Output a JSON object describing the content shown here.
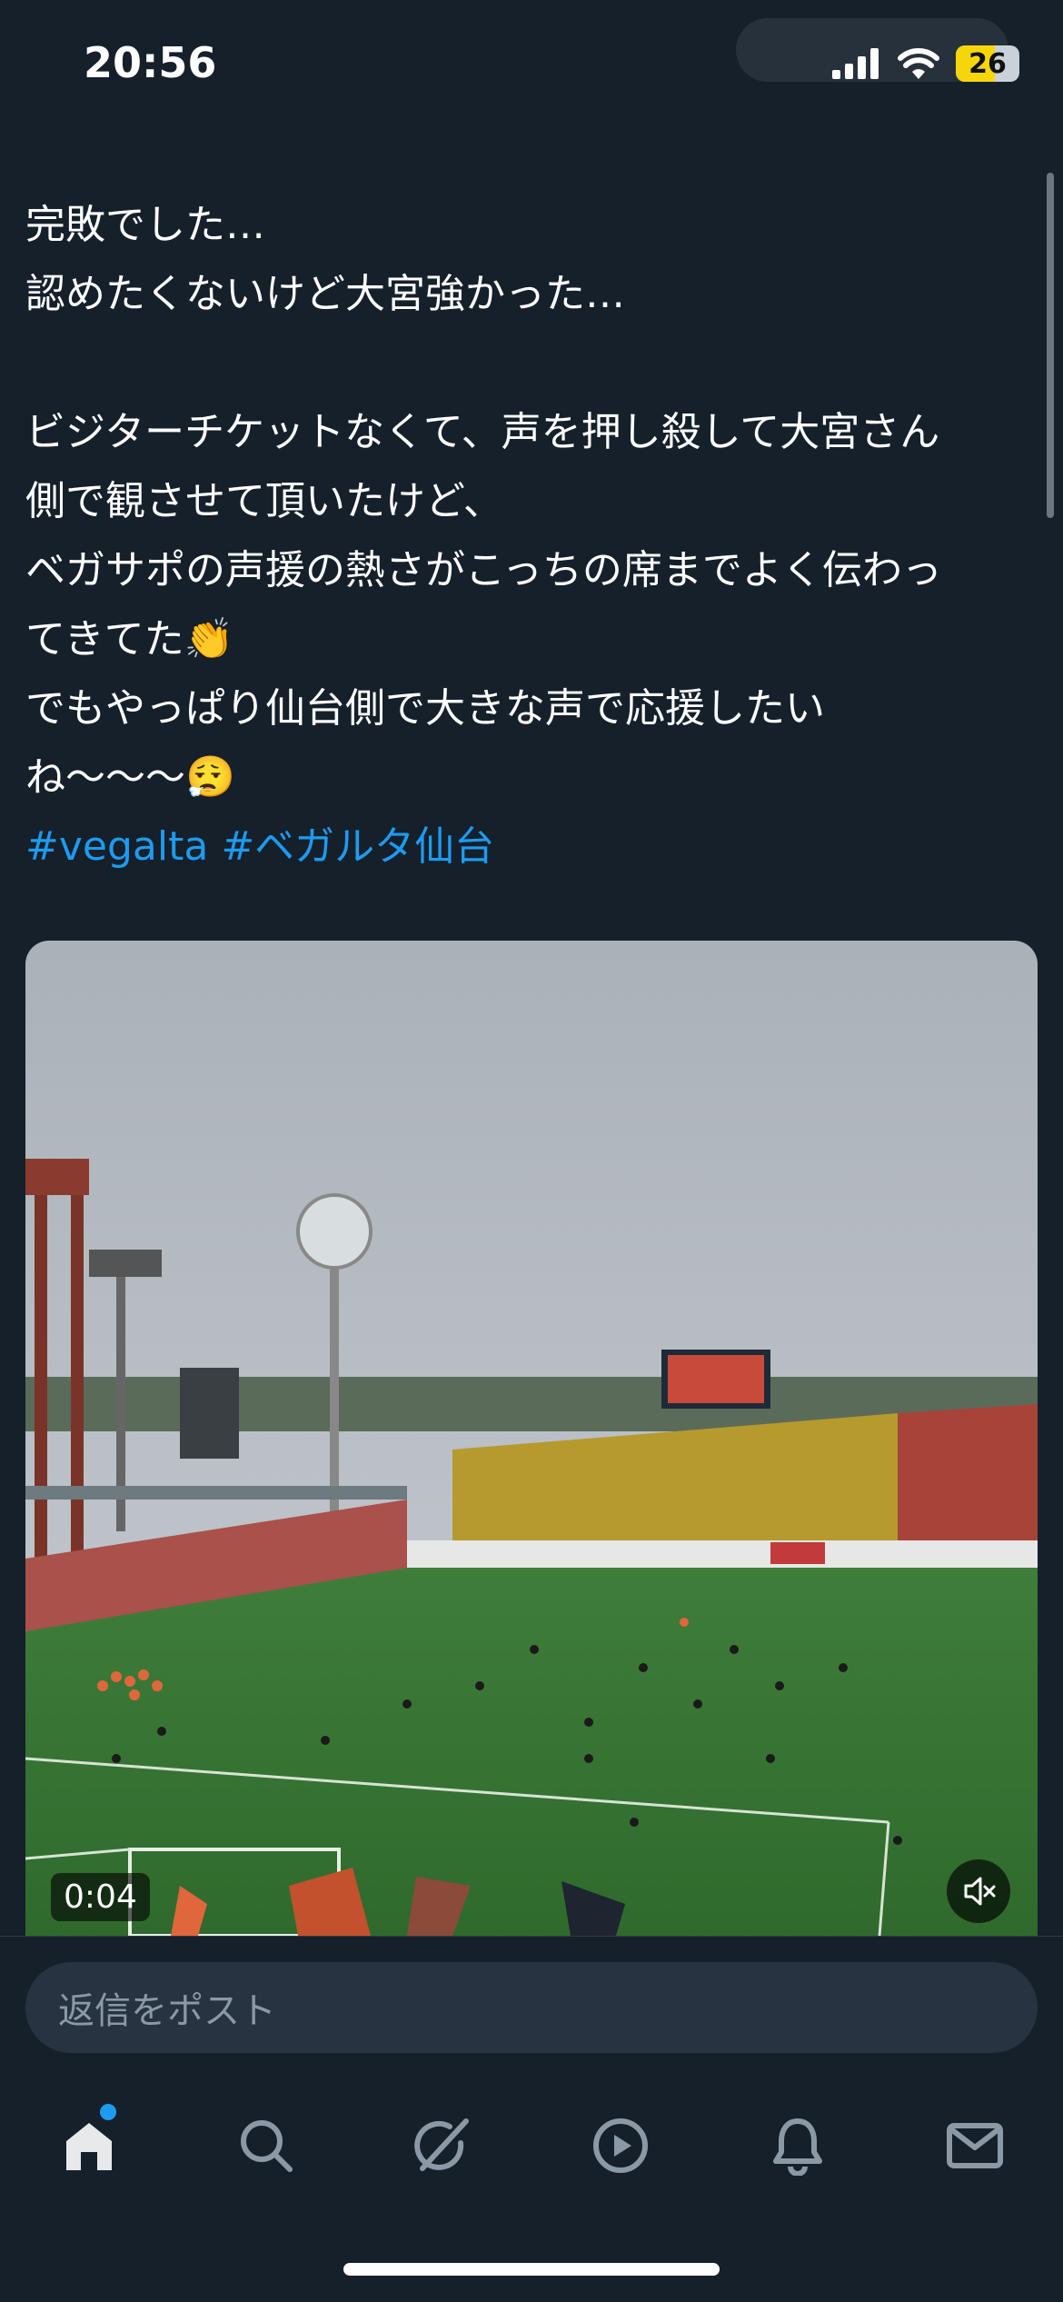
{
  "status_bar": {
    "time": "20:56",
    "battery": "26"
  },
  "post": {
    "lines": [
      "完敗でした…",
      "認めたくないけど大宮強かった…",
      "",
      "ビジターチケットなくて、声を押し殺して大宮さん",
      "側で観させて頂いたけど、",
      "ベガサポの声援の熱さがこっちの席までよく伝わっ",
      "てきてた👏",
      "でもやっぱり仙台側で大きな声で応援したい",
      "ね〜〜〜😮‍💨"
    ],
    "hashtags": [
      "#vegalta",
      "#ベガルタ仙台"
    ]
  },
  "video": {
    "duration": "0:04",
    "mute_icon": "speaker-muted-icon"
  },
  "reply": {
    "placeholder": "返信をポスト"
  },
  "tabbar": {
    "items": [
      {
        "name": "home",
        "icon": "home-icon",
        "active": true
      },
      {
        "name": "search",
        "icon": "search-icon"
      },
      {
        "name": "grok",
        "icon": "grok-icon"
      },
      {
        "name": "video",
        "icon": "play-icon"
      },
      {
        "name": "notifications",
        "icon": "bell-icon"
      },
      {
        "name": "messages",
        "icon": "mail-icon"
      }
    ]
  },
  "colors": {
    "background": "#15202b",
    "accent": "#1d9bf0",
    "text": "#e7e9ea"
  }
}
